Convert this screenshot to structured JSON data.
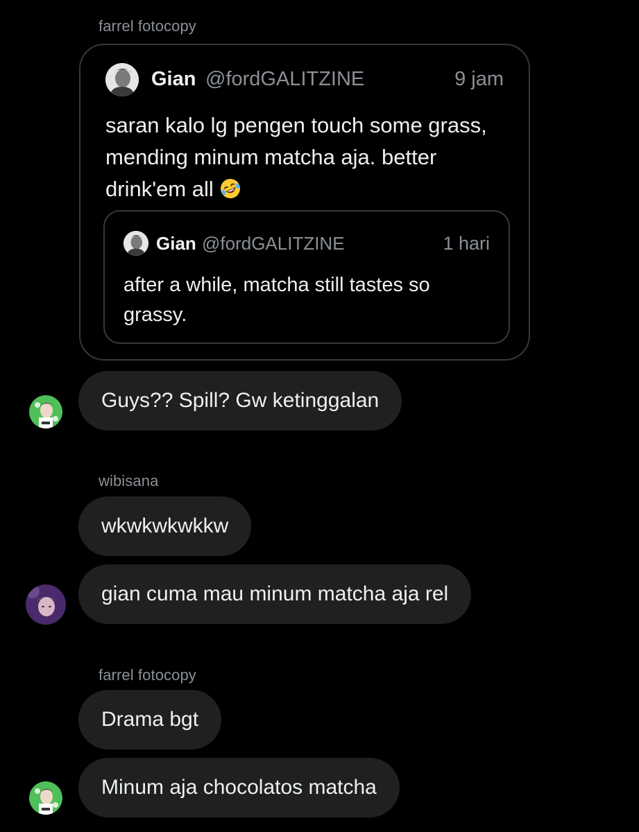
{
  "messages": [
    {
      "sender": "farrel fotocopy",
      "quote": {
        "name": "Gian",
        "handle": "@fordGALITZINE",
        "time": "9 jam",
        "text": "saran kalo lg pengen touch some grass, mending minum matcha aja. better drink'em all",
        "emoji": "rolling-on-floor-laughing-emoji",
        "nested": {
          "name": "Gian",
          "handle": "@fordGALITZINE",
          "time": "1 hari",
          "text": "after a while, matcha still tastes so grassy."
        }
      }
    },
    {
      "text": "Guys?? Spill? Gw ketinggalan"
    },
    {
      "sender": "wibisana",
      "text": "wkwkwkwkkw"
    },
    {
      "text": "gian cuma mau minum matcha aja rel"
    },
    {
      "sender": "farrel fotocopy",
      "text": "Drama bgt"
    },
    {
      "text": "Minum aja chocolatos matcha"
    }
  ],
  "colors": {
    "background": "#000000",
    "bubble": "#1f2022",
    "secondary_text": "#8b9096",
    "card_border": "#34383d"
  }
}
